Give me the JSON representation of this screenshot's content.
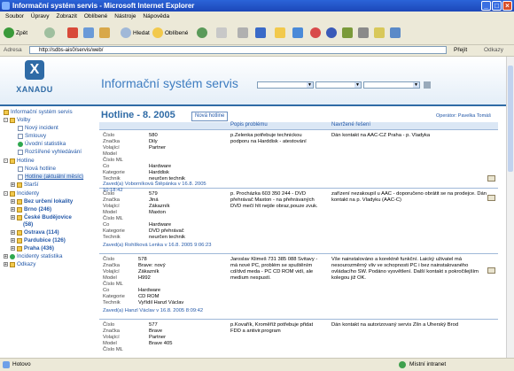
{
  "window": {
    "title": "Informační systém servis - Microsoft Internet Explorer"
  },
  "menu": [
    "Soubor",
    "Úpravy",
    "Zobrazit",
    "Oblíbené",
    "Nástroje",
    "Nápověda"
  ],
  "toolbar": {
    "back": "Zpět",
    "search": "Hledat",
    "favorites": "Oblíbené"
  },
  "address": {
    "label": "Adresa",
    "url": "http://sdbs-ais0/servis/web/",
    "go": "Přejít",
    "links": "Odkazy"
  },
  "app": {
    "logo_text": "XANADU",
    "title": "Informační systém servis"
  },
  "sidebar": {
    "root": "Informační systém servis",
    "volby": "Volby",
    "novy_incident": "Nový incident",
    "smlouvy": "Smlouvy",
    "uvodni_statistika": "Úvodní statistika",
    "rozsirene_vyhledavani": "Rozšířené vyhledávání",
    "hotline": "Hotline",
    "nova_hotline": "Nová hotline",
    "hotline_aktualni": "Hotline (aktuální měsíc)",
    "starsi": "Starší",
    "incidenty": "Incidenty",
    "inc_bez": "Bez určení lokality",
    "inc_brno": "Brno (246)",
    "inc_cb": "České Budějovice",
    "inc_cb2": "(58)",
    "inc_ostrava": "Ostrava (114)",
    "inc_pardubice": "Pardubice (126)",
    "inc_praha": "Praha (436)",
    "incidenty_stat": "Incidenty statistika",
    "odkazy": "Odkazy"
  },
  "main": {
    "title": "Hotline - 8. 2005",
    "new_button": "Nová hotline",
    "operator": "Operátor: Pavelka Tomáš",
    "col_desc": "Popis problému",
    "col_solution": "Navržené řešení"
  },
  "labels": {
    "cislo": "Číslo",
    "znacka": "Značka",
    "volajici": "Volající",
    "model": "Model",
    "cislo_ml": "Číslo ML",
    "co": "Co",
    "kategorie": "Kategorie",
    "technik": "Technik"
  },
  "records": [
    {
      "cislo": "580",
      "znacka": "Dily",
      "volajici": "Partner",
      "model": "",
      "cislo_ml": "",
      "co": "Hardware",
      "kategorie": "Harddisk",
      "technik": "neurčen technik",
      "zaved": "Zaved(a) Voborníková Štěpánka v 16.8. 2005 10:18:42",
      "desc": "p.Zelenka potřebuje technickou podporu na Harddisk - atestování",
      "solution": "Dán kontakt na AAC-CZ Praha - p. Vladyka"
    },
    {
      "cislo": "579",
      "znacka": "Jiná",
      "volajici": "Zákazník",
      "model": "Maxton",
      "cislo_ml": "",
      "co": "Hardware",
      "kategorie": "DVD přehrávač",
      "technik": "neurčen technik",
      "zaved": "Zaved(a) Rohlíková Lenka v 16.8. 2005 9:06:23",
      "desc": "p. Procházka 603 350 244 - DVD přehrávač Maxton - na přehrávaných DVD mečí hlt nejde obraz,pouze zvuk.",
      "solution": "zařízení nezakoupil u AAC - doporučeno obrátit se na prodejce. Dán kontakt na p. Vladyku (AAC-C)"
    },
    {
      "cislo": "578",
      "znacka": "Brave: nový",
      "volajici": "Zákazník",
      "model": "H992",
      "cislo_ml": "",
      "co": "Hardware",
      "kategorie": "CD ROM",
      "technik": "Vyřídil Hanzl Václav",
      "zaved": "Zaved(a) Hanzl Václav v 16.8. 2005 8:09:42",
      "desc": "Jaroslav Klimeš 731 385 088 Svitavy - má nové PC, problém se spuštěním cd/dvd meda - PC CD ROM vidí, ale medium nespustí.",
      "solution": "Vše nainstalováno a korektně funkční. Laický uživatel má nesourozměrný vliv ve schopnosti PC i bez nainstalovaného ovládacího SW. Podáno vysvětlení. Další kontakt s pokročilejším kolegou již OK."
    },
    {
      "cislo": "577",
      "znacka": "Brave",
      "volajici": "Partner",
      "model": "Brave 405",
      "cislo_ml": "",
      "co": "",
      "kategorie": "",
      "technik": "",
      "zaved": "",
      "desc": "p.Kovařík, Kroměříž potřebuje přidat FDD a antivir.program",
      "solution": "Dán kontakt na autorizovaný servis Zlín a Uherský Brod"
    }
  ],
  "status": {
    "left": "Hotovo",
    "right": "Místní intranet"
  }
}
